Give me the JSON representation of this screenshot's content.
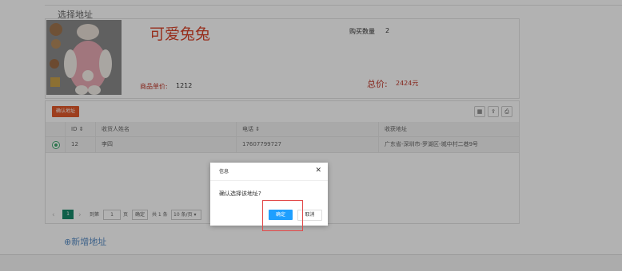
{
  "section": {
    "title": "选择地址"
  },
  "product": {
    "name": "可爱兔兔",
    "qty_label": "购买数量",
    "qty_value": "2",
    "price_label": "商品单价:",
    "price_value": "1212",
    "total_label": "总价:",
    "total_value": "2424元"
  },
  "toolbar": {
    "confirm_label": "确认地址",
    "icons": [
      "columns-icon",
      "export-icon",
      "print-icon"
    ]
  },
  "table": {
    "headers": [
      "ID",
      "收货人姓名",
      "电话",
      "收获地址"
    ],
    "rows": [
      {
        "id": "12",
        "name": "李四",
        "phone": "17607799727",
        "address": "广东省-深圳市-罗湖区-城中村二巷9号",
        "selected": true
      }
    ]
  },
  "pager": {
    "prev": "‹",
    "current": "1",
    "next": "›",
    "goto_label": "到第",
    "goto_value": "1",
    "page_unit": "页",
    "go_label": "确定",
    "total": "共 1 条",
    "size": "10 条/页"
  },
  "add_address": "新增地址",
  "dialog": {
    "title": "信息",
    "close": "✕",
    "message": "确认选择该地址?",
    "ok": "确定",
    "cancel": "取消"
  },
  "colors": {
    "accent_orange": "#e15a2c",
    "price_red": "#c0392b",
    "ok_blue": "#1e9fff",
    "pager_green": "#178a6b",
    "highlight_red": "#e24a4a"
  }
}
